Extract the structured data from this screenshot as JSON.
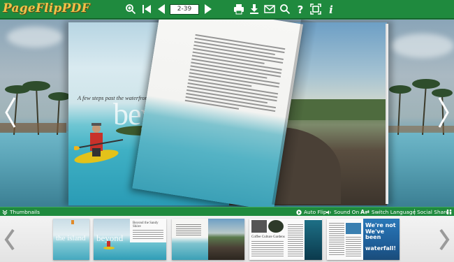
{
  "app": {
    "logo_text": "PageFlipPDF"
  },
  "toolbar": {
    "page_indicator": "2-39",
    "icons": [
      "zoom-in-icon",
      "first-page-icon",
      "previous-page-icon",
      "next-page-icon",
      "last-page-icon",
      "print-icon",
      "download-icon",
      "email-icon",
      "search-icon",
      "help-icon",
      "fullscreen-icon",
      "info-icon"
    ]
  },
  "book": {
    "left_page": {
      "caption": "A few steps past the waterfront and the margarita bar",
      "headline": "beyo"
    }
  },
  "bottombar": {
    "thumbnails_label": "Thumbnails",
    "auto_flip_label": "Auto Flip",
    "sound_label": "Sound On",
    "language_label": "Switch Language",
    "social_label": "Social Share"
  },
  "thumbnails": {
    "spreads": [
      {
        "pages": [
          "p1"
        ],
        "text": [
          "the island"
        ]
      },
      {
        "pages": [
          "p2",
          "p3"
        ],
        "text": [
          "beyond",
          "Beyond the Sandy Shore"
        ]
      },
      {
        "pages": [
          "p4",
          "p5"
        ],
        "text": []
      },
      {
        "pages": [
          "p6",
          "p7"
        ],
        "text": [
          "Coffee Culture Gardens"
        ]
      },
      {
        "pages": [
          "p8",
          "p9"
        ],
        "text": [
          "We're not",
          "We've been",
          "waterfall!"
        ]
      }
    ]
  },
  "colors": {
    "toolbar_bg": "#1f8a3e",
    "logo": "#f0c24a",
    "thumb_bg": "#ececec"
  }
}
